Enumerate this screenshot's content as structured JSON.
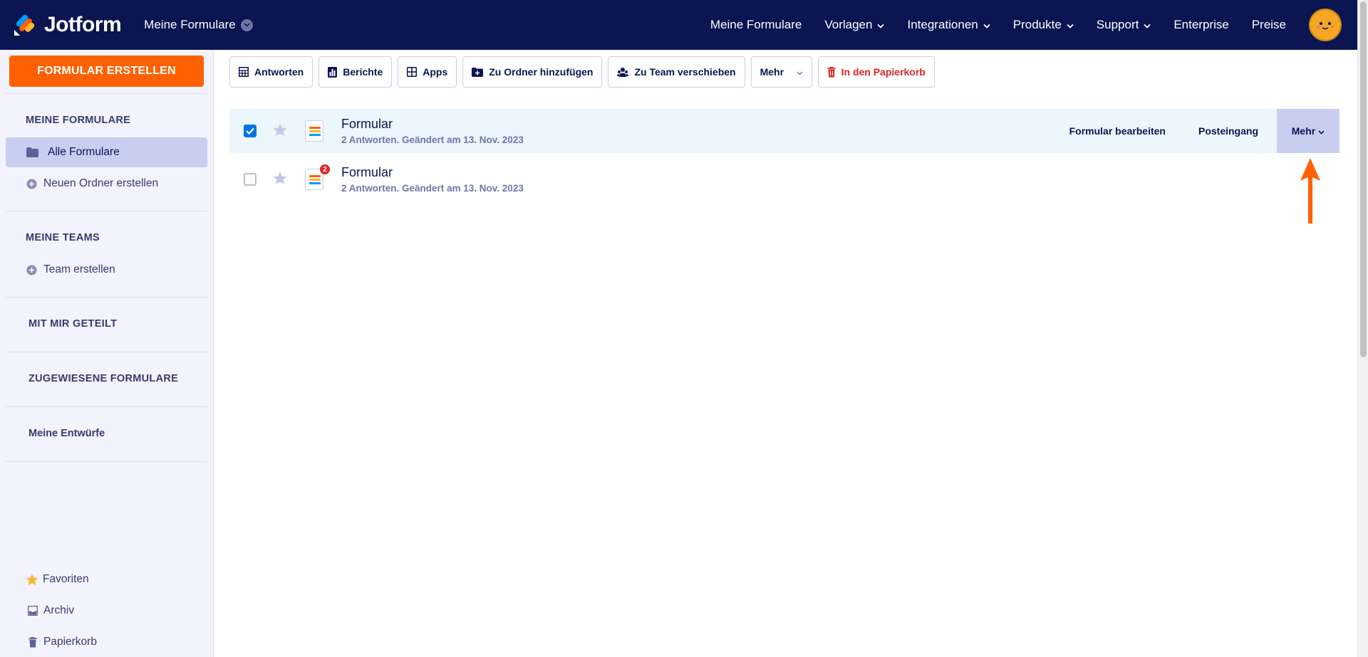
{
  "brand": {
    "name": "Jotform",
    "colors": {
      "nav_bg": "#0a1551",
      "accent": "#ff6100",
      "selected_row": "#ecf6fd",
      "active_item": "#c8cef0",
      "danger": "#dc2626",
      "checkbox": "#0075e3"
    }
  },
  "header": {
    "workspace": "Meine Formulare",
    "nav": [
      {
        "label": "Meine Formulare",
        "dropdown": false
      },
      {
        "label": "Vorlagen",
        "dropdown": true
      },
      {
        "label": "Integrationen",
        "dropdown": true
      },
      {
        "label": "Produkte",
        "dropdown": true
      },
      {
        "label": "Support",
        "dropdown": true
      },
      {
        "label": "Enterprise",
        "dropdown": false
      },
      {
        "label": "Preise",
        "dropdown": false
      }
    ],
    "avatar_icon": "user-avatar"
  },
  "sidebar": {
    "create_button": "FORMULAR ERSTELLEN",
    "sections": {
      "my_forms": "MEINE FORMULARE",
      "my_teams": "MEINE TEAMS",
      "shared": "MIT MIR GETEILT",
      "assigned": "ZUGEWIESENE FORMULARE",
      "drafts": "Meine Entwürfe"
    },
    "items": {
      "all_forms": "Alle Formulare",
      "new_folder": "Neuen Ordner erstellen",
      "create_team": "Team erstellen",
      "favorites": "Favoriten",
      "archive": "Archiv",
      "trash": "Papierkorb"
    }
  },
  "toolbar": {
    "responses": "Antworten",
    "reports": "Berichte",
    "apps": "Apps",
    "add_to_folder": "Zu Ordner hinzufügen",
    "move_to_team": "Zu Team verschieben",
    "more": "Mehr",
    "trash": "In den Papierkorb"
  },
  "forms": [
    {
      "title": "Formular",
      "subtitle": "2 Antworten. Geändert am 13. Nov. 2023",
      "selected": true,
      "starred": false,
      "badge": ""
    },
    {
      "title": "Formular",
      "subtitle": "2 Antworten. Geändert am 13. Nov. 2023",
      "selected": false,
      "starred": false,
      "badge": "2"
    }
  ],
  "row_actions": {
    "edit": "Formular bearbeiten",
    "inbox": "Posteingang",
    "more": "Mehr"
  }
}
